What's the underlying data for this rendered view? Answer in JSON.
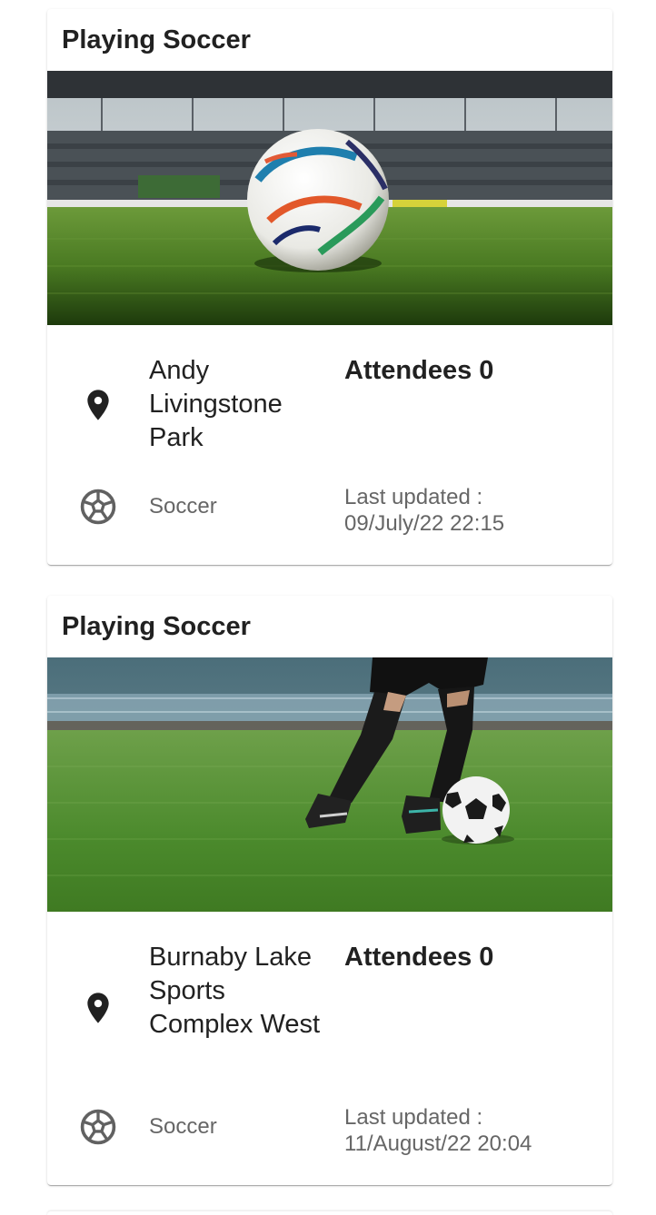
{
  "cards": [
    {
      "title": "Playing Soccer",
      "image_icon": "soccer-ball-stadium-photo",
      "location": "Andy Livingstone Park",
      "attendees_label": "Attendees 0",
      "sport": "Soccer",
      "updated_label": "Last updated :",
      "updated_value": "09/July/22 22:15"
    },
    {
      "title": "Playing Soccer",
      "image_icon": "soccer-player-kicking-photo",
      "location": "Burnaby Lake Sports Complex West",
      "attendees_label": "Attendees 0",
      "sport": "Soccer",
      "updated_label": "Last updated :",
      "updated_value": "11/August/22 20:04"
    }
  ],
  "icons": {
    "location": "location-pin-icon",
    "sport": "soccer-ball-icon"
  },
  "colors": {
    "text_primary": "#212121",
    "text_secondary": "#666666",
    "grass": "#4f8a2a"
  }
}
